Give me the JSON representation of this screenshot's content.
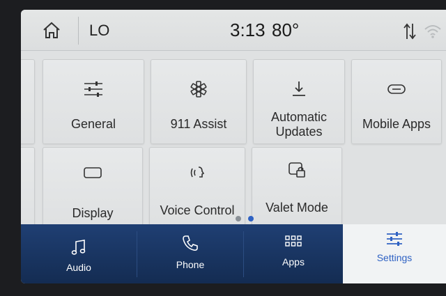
{
  "status_bar": {
    "climate_label": "LO",
    "time": "3:13",
    "temperature": "80°",
    "icons": [
      "home-icon",
      "data-transfer-icon",
      "wifi-icon"
    ]
  },
  "settings_tiles": [
    {
      "label": "General",
      "icon": "sliders-icon"
    },
    {
      "label": "911 Assist",
      "icon": "emergency-star-icon"
    },
    {
      "label": "Automatic Updates",
      "icon": "download-icon"
    },
    {
      "label": "Mobile Apps",
      "icon": "mobile-apps-icon"
    },
    {
      "label": "Display",
      "icon": "display-icon"
    },
    {
      "label": "Voice Control",
      "icon": "voice-icon"
    },
    {
      "label": "Valet Mode",
      "icon": "valet-lock-icon"
    }
  ],
  "pagination": {
    "pages": 2,
    "current": 2
  },
  "bottom_nav": [
    {
      "label": "Audio",
      "icon": "music-note-icon"
    },
    {
      "label": "Phone",
      "icon": "phone-icon"
    },
    {
      "label": "Apps",
      "icon": "apps-grid-icon"
    },
    {
      "label": "Settings",
      "icon": "settings-sliders-icon",
      "active": true
    }
  ],
  "colors": {
    "accent": "#2f62c3",
    "nav_background": "#1a3766",
    "screen_background": "#dfe1e2"
  }
}
